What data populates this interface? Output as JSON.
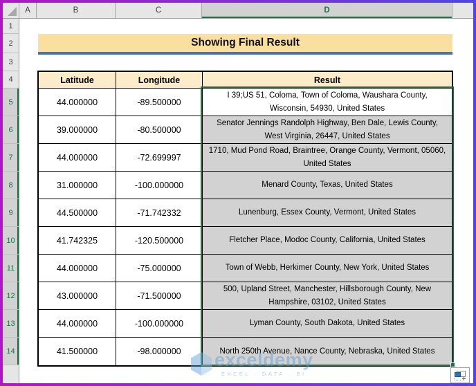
{
  "chrome": {
    "column_headers": [
      "A",
      "B",
      "C",
      "D"
    ],
    "selected_column": "D",
    "row_numbers": [
      "1",
      "2",
      "3",
      "4",
      "5",
      "6",
      "7",
      "8",
      "9",
      "10",
      "11",
      "12",
      "13",
      "14"
    ],
    "selected_rows": "5-14"
  },
  "title": {
    "text": "Showing Final Result"
  },
  "table": {
    "headers": {
      "lat": "Latitude",
      "lng": "Longitude",
      "result": "Result"
    },
    "rows": [
      {
        "lat": "44.000000",
        "lng": "-89.500000",
        "result": "I 39;US 51, Coloma, Town of Coloma, Waushara County, Wisconsin, 54930, United States"
      },
      {
        "lat": "39.000000",
        "lng": "-80.500000",
        "result": "Senator Jennings Randolph Highway, Ben Dale, Lewis County, West Virginia, 26447, United States"
      },
      {
        "lat": "44.000000",
        "lng": "-72.699997",
        "result": "1710, Mud Pond Road, Braintree, Orange County, Vermont, 05060, United States"
      },
      {
        "lat": "31.000000",
        "lng": "-100.000000",
        "result": "Menard County, Texas, United States"
      },
      {
        "lat": "44.500000",
        "lng": "-71.742332",
        "result": "Lunenburg, Essex County, Vermont, United States"
      },
      {
        "lat": "41.742325",
        "lng": "-120.500000",
        "result": "Fletcher Place, Modoc County, California, United States"
      },
      {
        "lat": "44.000000",
        "lng": "-75.000000",
        "result": "Town of Webb, Herkimer County, New York, United States"
      },
      {
        "lat": "43.000000",
        "lng": "-71.500000",
        "result": "500, Upland Street, Manchester, Hillsborough County, New Hampshire, 03102, United States"
      },
      {
        "lat": "44.000000",
        "lng": "-100.000000",
        "result": "Lyman County, South Dakota, United States"
      },
      {
        "lat": "41.500000",
        "lng": "-98.000000",
        "result": "North 250th Avenue, Nance County, Nebraska, United States"
      }
    ]
  },
  "watermark": {
    "brand": "exceldemy",
    "tagline": "EXCEL · DATA · BI"
  },
  "icons": {
    "select_all": "corner-triangle",
    "paste_options": "clipboard-paste-options",
    "fill_handle": "selection-fill-handle"
  },
  "colors": {
    "title_bg": "#FADF9E",
    "table_header_bg": "#FCECCA",
    "accent_blue": "#4472C4",
    "selection_green": "#1E7145",
    "selected_cell_fill": "#D2D2D2",
    "chrome_header_bg": "#E6E6E6",
    "watermark_blue": "#5B9BD5",
    "frame_gradient_left": "#B116C4",
    "frame_gradient_right": "#4F46E5"
  }
}
